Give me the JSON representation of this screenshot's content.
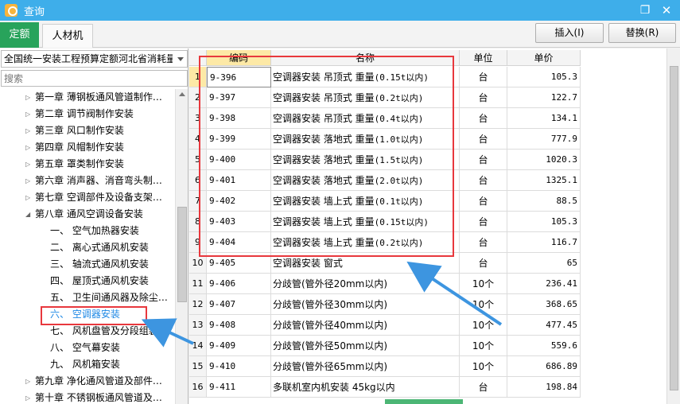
{
  "window": {
    "title": "查询",
    "restore_glyph": "❐",
    "close_glyph": "✕"
  },
  "tabs": [
    {
      "label": "定额"
    },
    {
      "label": "人材机"
    }
  ],
  "toolbar": {
    "insert_label": "插入(I)",
    "replace_label": "替换(R)"
  },
  "left": {
    "library_select": "全国统一安装工程预算定额河北省消耗量",
    "search_placeholder": "搜索",
    "tree": [
      {
        "label": "第一章 薄钢板通风管道制作…",
        "expander": "▷"
      },
      {
        "label": "第二章 调节阀制作安装",
        "expander": "▷"
      },
      {
        "label": "第三章 风口制作安装",
        "expander": "▷"
      },
      {
        "label": "第四章 风帽制作安装",
        "expander": "▷"
      },
      {
        "label": "第五章 罩类制作安装",
        "expander": "▷"
      },
      {
        "label": "第六章 消声器、消音弯头制…",
        "expander": "▷"
      },
      {
        "label": "第七章 空调部件及设备支架…",
        "expander": "▷"
      },
      {
        "label": "第八章 通风空调设备安装",
        "expander": "◢"
      },
      {
        "label": "一、 空气加热器安装"
      },
      {
        "label": "二、 离心式通风机安装"
      },
      {
        "label": "三、 轴流式通风机安装"
      },
      {
        "label": "四、 屋顶式通风机安装"
      },
      {
        "label": "五、 卫生间通风器及除尘…"
      },
      {
        "label": "六、 空调器安装"
      },
      {
        "label": "七、 风机盘管及分段组装…"
      },
      {
        "label": "八、 空气幕安装"
      },
      {
        "label": "九、 风机箱安装"
      },
      {
        "label": "第九章 净化通风管道及部件…",
        "expander": "▷"
      },
      {
        "label": "第十章 不锈钢板通风管道及…",
        "expander": "▷"
      }
    ]
  },
  "table": {
    "headers": {
      "code": "编码",
      "name": "名称",
      "unit": "单位",
      "price": "单价"
    },
    "rows": [
      {
        "n": "1",
        "code": "9-396",
        "name": "空调器安装 吊顶式 重量",
        "spec": "(0.15t以内)",
        "unit": "台",
        "price": "105.3"
      },
      {
        "n": "2",
        "code": "9-397",
        "name": "空调器安装 吊顶式 重量",
        "spec": "(0.2t以内)",
        "unit": "台",
        "price": "122.7"
      },
      {
        "n": "3",
        "code": "9-398",
        "name": "空调器安装 吊顶式 重量",
        "spec": "(0.4t以内)",
        "unit": "台",
        "price": "134.1"
      },
      {
        "n": "4",
        "code": "9-399",
        "name": "空调器安装 落地式 重量",
        "spec": "(1.0t以内)",
        "unit": "台",
        "price": "777.9"
      },
      {
        "n": "5",
        "code": "9-400",
        "name": "空调器安装 落地式 重量",
        "spec": "(1.5t以内)",
        "unit": "台",
        "price": "1020.3"
      },
      {
        "n": "6",
        "code": "9-401",
        "name": "空调器安装 落地式 重量",
        "spec": "(2.0t以内)",
        "unit": "台",
        "price": "1325.1"
      },
      {
        "n": "7",
        "code": "9-402",
        "name": "空调器安装 墙上式 重量",
        "spec": "(0.1t以内)",
        "unit": "台",
        "price": "88.5"
      },
      {
        "n": "8",
        "code": "9-403",
        "name": "空调器安装 墙上式 重量",
        "spec": "(0.15t以内)",
        "unit": "台",
        "price": "105.3"
      },
      {
        "n": "9",
        "code": "9-404",
        "name": "空调器安装 墙上式 重量",
        "spec": "(0.2t以内)",
        "unit": "台",
        "price": "116.7"
      },
      {
        "n": "10",
        "code": "9-405",
        "name": "空调器安装 窗式",
        "spec": "",
        "unit": "台",
        "price": "65"
      },
      {
        "n": "11",
        "code": "9-406",
        "name": "分歧管(管外径20mm以内)",
        "spec": "",
        "unit": "10个",
        "price": "236.41"
      },
      {
        "n": "12",
        "code": "9-407",
        "name": "分歧管(管外径30mm以内)",
        "spec": "",
        "unit": "10个",
        "price": "368.65"
      },
      {
        "n": "13",
        "code": "9-408",
        "name": "分歧管(管外径40mm以内)",
        "spec": "",
        "unit": "10个",
        "price": "477.45"
      },
      {
        "n": "14",
        "code": "9-409",
        "name": "分歧管(管外径50mm以内)",
        "spec": "",
        "unit": "10个",
        "price": "559.6"
      },
      {
        "n": "15",
        "code": "9-410",
        "name": "分歧管(管外径65mm以内)",
        "spec": "",
        "unit": "10个",
        "price": "686.89"
      },
      {
        "n": "16",
        "code": "9-411",
        "name": "多联机室内机安装 45kg以内",
        "spec": "",
        "unit": "台",
        "price": "198.84"
      }
    ]
  },
  "colors": {
    "titlebar": "#3eaeea",
    "active_tab": "#28a35b",
    "annotation": "#e8383d",
    "arrow": "#3d95e0",
    "selected_text": "#1e88e5"
  }
}
